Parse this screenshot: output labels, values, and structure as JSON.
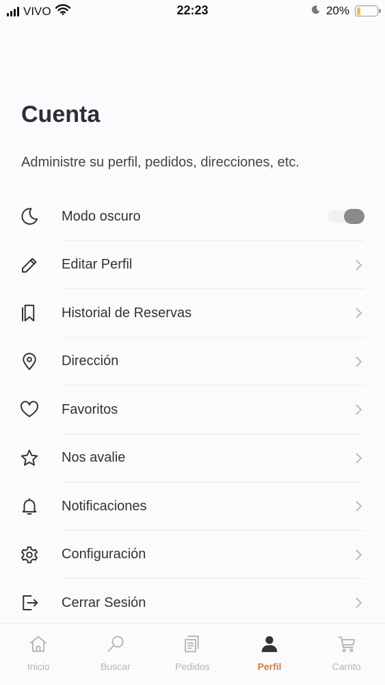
{
  "status_bar": {
    "carrier": "VIVO",
    "time": "22:23",
    "battery": "20%",
    "battery_level": 0.2,
    "icons": [
      "signal-icon",
      "wifi-icon",
      "moon-icon",
      "battery-icon"
    ]
  },
  "header": {
    "title": "Cuenta",
    "subtitle": "Administre su perfil, pedidos, direcciones, etc."
  },
  "menu": {
    "items": [
      {
        "label": "Modo oscuro",
        "icon": "moon-icon",
        "type": "toggle",
        "on": false
      },
      {
        "label": "Editar Perfil",
        "icon": "pencil-icon"
      },
      {
        "label": "Historial de Reservas",
        "icon": "bookmarks-icon"
      },
      {
        "label": "Dirección",
        "icon": "location-pin-icon"
      },
      {
        "label": "Favoritos",
        "icon": "heart-icon"
      },
      {
        "label": "Nos avalie",
        "icon": "star-icon"
      },
      {
        "label": "Notificaciones",
        "icon": "bell-icon"
      },
      {
        "label": "Configuración",
        "icon": "gear-icon"
      },
      {
        "label": "Cerrar Sesión",
        "icon": "logout-icon"
      }
    ]
  },
  "bottom_nav": {
    "items": [
      {
        "label": "Inicio",
        "icon": "home-icon"
      },
      {
        "label": "Buscar",
        "icon": "search-icon"
      },
      {
        "label": "Pedidos",
        "icon": "receipt-icon"
      },
      {
        "label": "Perfil",
        "icon": "user-icon",
        "active": true
      },
      {
        "label": "Carrito",
        "icon": "cart-icon"
      }
    ]
  },
  "colors": {
    "accent": "#d77a3c",
    "background": "#fbfafc",
    "text": "#333333"
  }
}
